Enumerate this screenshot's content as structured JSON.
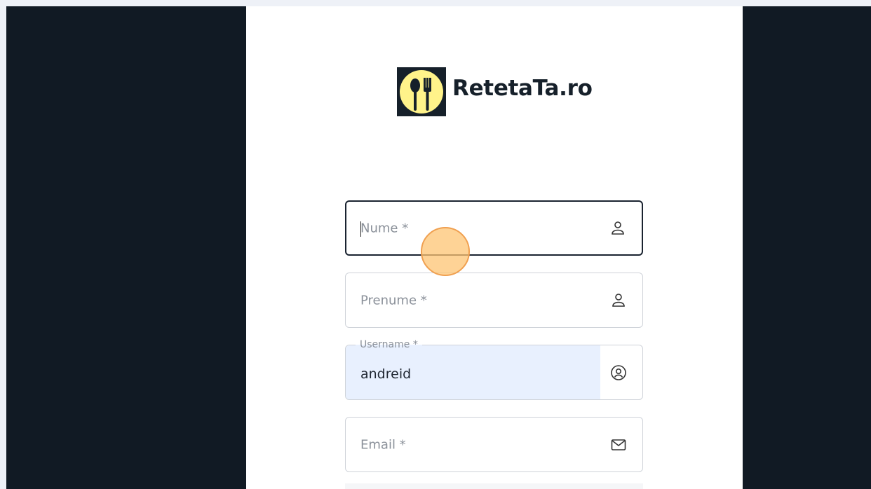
{
  "brand": {
    "name": "RetetaTa.ro"
  },
  "form": {
    "nume": {
      "placeholder": "Nume *",
      "icon": "user-icon"
    },
    "prenume": {
      "placeholder": "Prenume *",
      "icon": "user-icon"
    },
    "username": {
      "label": "Username *",
      "value": "andreid",
      "icon": "user-circle-icon"
    },
    "email": {
      "placeholder": "Email *",
      "icon": "mail-icon"
    }
  },
  "colors": {
    "sidebar": "#111a24",
    "logo_bg": "#16202a",
    "logo_circle": "#fff38a",
    "autofill": "#e8f0fe",
    "focus_border": "#1a2330",
    "click_marker": "#fdc473"
  }
}
